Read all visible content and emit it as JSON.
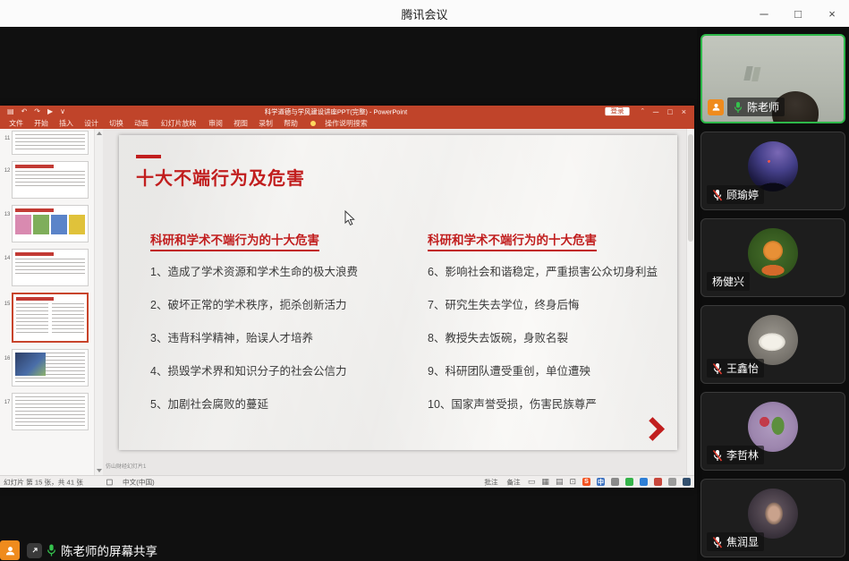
{
  "window": {
    "title": "腾讯会议",
    "controls": {
      "minimize": "─",
      "maximize": "□",
      "close": "×"
    }
  },
  "ppt": {
    "title": "科学道德与学风建设讲座PPT(完整)  -  PowerPoint",
    "qa": [
      "▤",
      "↶",
      "↷",
      "▶",
      "∨"
    ],
    "login_label": "登录",
    "controls": {
      "opts": "ˆ",
      "minimize": "─",
      "maximize": "□",
      "close": "×"
    },
    "ribbon_tabs": [
      "文件",
      "开始",
      "插入",
      "设计",
      "切换",
      "动画",
      "幻灯片放映",
      "审阅",
      "视图",
      "录制",
      "帮助"
    ],
    "search_label": "操作说明搜索",
    "thumbnails": [
      {
        "num": "11"
      },
      {
        "num": "12"
      },
      {
        "num": "13"
      },
      {
        "num": "14"
      },
      {
        "num": "15"
      },
      {
        "num": "16"
      },
      {
        "num": "17"
      }
    ],
    "slide": {
      "title": "十大不端行为及危害",
      "left_heading": "科研和学术不端行为的十大危害",
      "right_heading": "科研和学术不端行为的十大危害",
      "left_items": [
        "1、造成了学术资源和学术生命的极大浪费",
        "2、破坏正常的学术秩序，扼杀创新活力",
        "3、违背科学精神，贻误人才培养",
        "4、损毁学术界和知识分子的社会公信力",
        "5、加剧社会腐败的蔓延"
      ],
      "right_items": [
        "6、影响社会和谐稳定，严重损害公众切身利益",
        "7、研究生失去学位，终身后悔",
        "8、教授失去饭碗，身败名裂",
        "9、科研团队遭受重创，单位遭殃",
        "10、国家声誉受损，伤害民族尊严"
      ]
    },
    "off_slide_text": "仿山财经幻灯片1",
    "status": {
      "slide_info": "幻灯片 第 15 张，共 41 张",
      "language": "中文(中国)",
      "comments_label": "批注",
      "notes_label": "备注",
      "view_icons": [
        "▭",
        "▦",
        "▤",
        "⊡"
      ],
      "tray": {
        "sogou": "S",
        "ime_cn": "中"
      }
    }
  },
  "sidebar": {
    "participants": [
      {
        "name": "陈老师",
        "mic": "on",
        "speaking": true,
        "video": true,
        "host": true
      },
      {
        "name": "顾瑜婷",
        "mic": "muted"
      },
      {
        "name": "杨健兴",
        "mic": "none"
      },
      {
        "name": "王鑫怡",
        "mic": "muted"
      },
      {
        "name": "李哲林",
        "mic": "muted"
      },
      {
        "name": "焦润显",
        "mic": "muted"
      }
    ]
  },
  "share_banner": {
    "text": "陈老师的屏幕共享"
  },
  "colors": {
    "ppt_accent": "#c0442a",
    "slide_red": "#c11e1e",
    "speaking_green": "#2eb84a",
    "host_orange": "#ef8b1d",
    "mute_red": "#e23b2e"
  }
}
